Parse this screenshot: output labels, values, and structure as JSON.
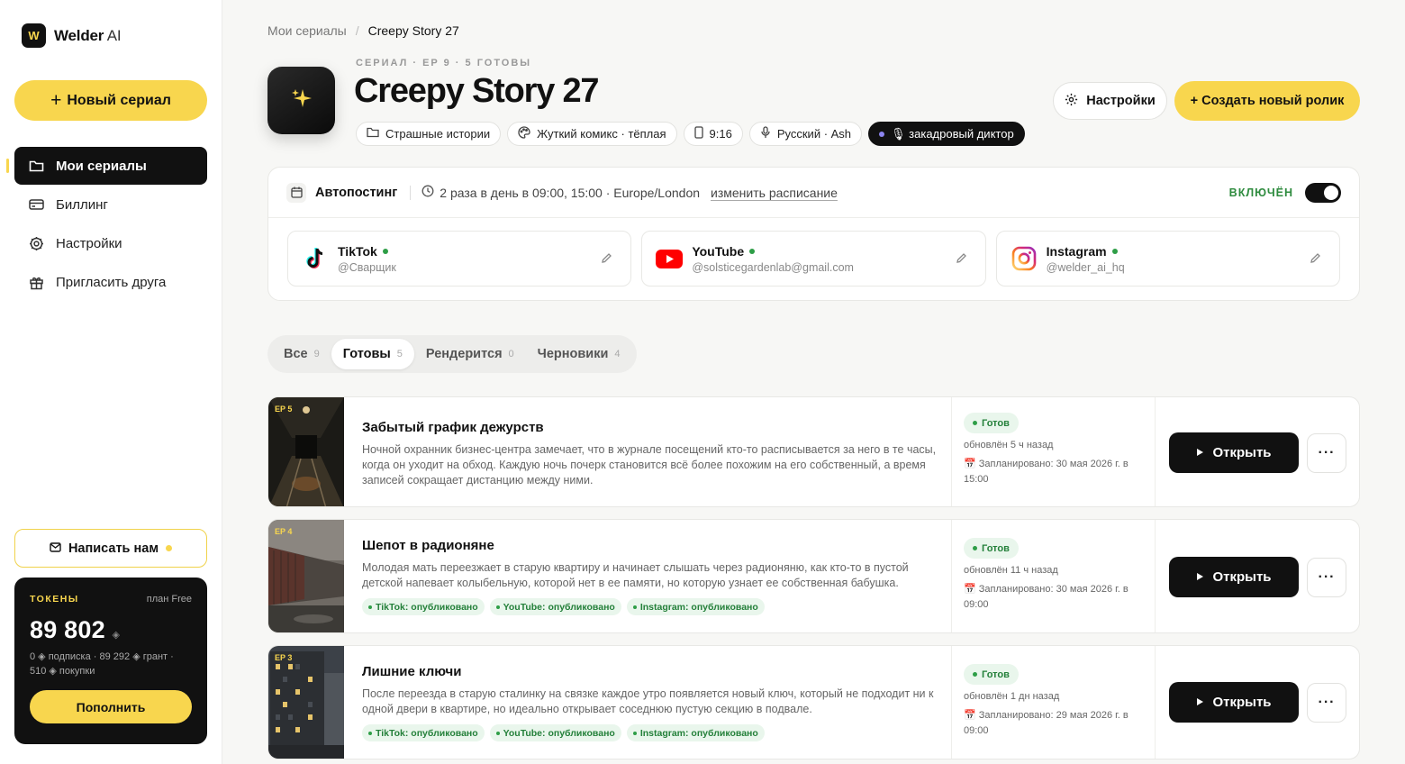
{
  "app": {
    "logo_mark": "W",
    "logo_name": "Welder",
    "logo_suffix": " AI"
  },
  "sidebar": {
    "new_series": "Новый сериал",
    "items": [
      {
        "label": "Мои сериалы",
        "icon": "folder-icon"
      },
      {
        "label": "Биллинг",
        "icon": "card-icon"
      },
      {
        "label": "Настройки",
        "icon": "gear-icon"
      },
      {
        "label": "Пригласить друга",
        "icon": "gift-icon"
      }
    ],
    "contact": "Написать нам",
    "tokens": {
      "label": "ТОКЕНЫ",
      "plan": "план Free",
      "value": "89 802",
      "unit_symbol": "◈",
      "breakdown": "0 ◈ подписка · 89 292 ◈ грант · 510 ◈ покупки",
      "topup": "Пополнить"
    }
  },
  "breadcrumb": {
    "parent": "Мои сериалы",
    "separator": "/",
    "current": "Creepy Story 27"
  },
  "series": {
    "meta": "СЕРИАЛ · EP 9 · 5 ГОТОВЫ",
    "title": "Creepy Story 27",
    "chips": [
      {
        "label": "Страшные истории",
        "icon": "folder-icon"
      },
      {
        "label": "Жуткий комикс · тёплая",
        "icon": "palette-icon"
      },
      {
        "label": "9:16",
        "icon": "phone-icon"
      },
      {
        "label": "Русский · Ash",
        "icon": "mic-icon"
      },
      {
        "label": "🎙 закадровый диктор",
        "icon": "dot-icon",
        "dark": true
      }
    ],
    "settings_button": "Настройки",
    "create_button": "+ Создать новый ролик"
  },
  "autopost": {
    "title": "Автопостинг",
    "schedule": "2 раза в день в 09:00, 15:00 · Europe/London",
    "change": "изменить расписание",
    "status": "ВКЛЮЧЁН",
    "enabled": true,
    "accounts": [
      {
        "platform": "TikTok",
        "handle": "@Сварщик",
        "icon": "tiktok-icon"
      },
      {
        "platform": "YouTube",
        "handle": "@solsticegardenlab@gmail.com",
        "icon": "youtube-icon"
      },
      {
        "platform": "Instagram",
        "handle": "@welder_ai_hq",
        "icon": "instagram-icon"
      }
    ]
  },
  "tabs": [
    {
      "label": "Все",
      "count": "9"
    },
    {
      "label": "Готовы",
      "count": "5",
      "active": true
    },
    {
      "label": "Рендерится",
      "count": "0"
    },
    {
      "label": "Черновики",
      "count": "4"
    }
  ],
  "episodes": [
    {
      "badge": "EP 5",
      "title": "Забытый график дежурств",
      "description": "Ночной охранник бизнес-центра замечает, что в журнале посещений кто-то расписывается за него в те часы, когда он уходит на обход. Каждую ночь почерк становится всё более похожим на его собственный, а время записей сокращает дистанцию между ними.",
      "tags": [],
      "status": "Готов",
      "updated": "обновлён 5 ч назад",
      "scheduled": "📅 Запланировано: 30 мая 2026 г. в 15:00",
      "open": "Открыть",
      "more": "···"
    },
    {
      "badge": "EP 4",
      "title": "Шепот в радионяне",
      "description": "Молодая мать переезжает в старую квартиру и начинает слышать через радионяню, как кто-то в пустой детской напевает колыбельную, которой нет в ее памяти, но которую узнает ее собственная бабушка.",
      "tags": [
        "TikTok: опубликовано",
        "YouTube: опубликовано",
        "Instagram: опубликовано"
      ],
      "status": "Готов",
      "updated": "обновлён 11 ч назад",
      "scheduled": "📅 Запланировано: 30 мая 2026 г. в 09:00",
      "open": "Открыть",
      "more": "···"
    },
    {
      "badge": "EP 3",
      "title": "Лишние ключи",
      "description": "После переезда в старую сталинку на связке каждое утро появляется новый ключ, который не подходит ни к одной двери в квартире, но идеально открывает соседнюю пустую секцию в подвале.",
      "tags": [
        "TikTok: опубликовано",
        "YouTube: опубликовано",
        "Instagram: опубликовано"
      ],
      "status": "Готов",
      "updated": "обновлён 1 дн назад",
      "scheduled": "📅 Запланировано: 29 мая 2026 г. в 09:00",
      "open": "Открыть",
      "more": "···"
    }
  ]
}
